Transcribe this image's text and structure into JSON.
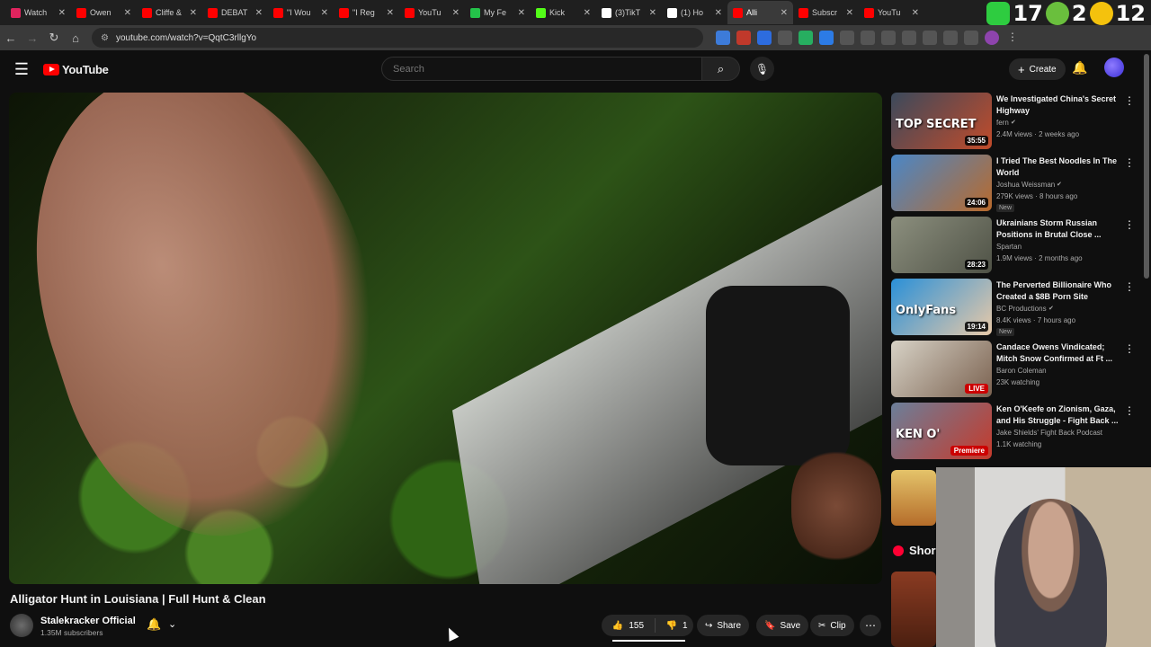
{
  "browser": {
    "tabs": [
      {
        "label": "Watch",
        "favicon_color": "#e0245e"
      },
      {
        "label": "Owen",
        "favicon_color": "#ff0000"
      },
      {
        "label": "Cliffe &",
        "favicon_color": "#ff0000"
      },
      {
        "label": "DEBAT",
        "favicon_color": "#ff0000"
      },
      {
        "label": "\"I Wou",
        "favicon_color": "#ff0000"
      },
      {
        "label": "\"I Reg",
        "favicon_color": "#ff0000"
      },
      {
        "label": "YouTu",
        "favicon_color": "#ff0000"
      },
      {
        "label": "My Fe",
        "favicon_color": "#24c24a"
      },
      {
        "label": "Kick",
        "favicon_color": "#53fc18"
      },
      {
        "label": "(3)TikT",
        "favicon_color": "#ffffff"
      },
      {
        "label": "(1) Ho",
        "favicon_color": "#ffffff"
      },
      {
        "label": "Alli",
        "favicon_color": "#ff0000"
      },
      {
        "label": "Subscr",
        "favicon_color": "#ff0000"
      },
      {
        "label": "YouTu",
        "favicon_color": "#ff0000"
      }
    ],
    "active_tab_index": 11,
    "url": "youtube.com/watch?v=QqtC3rllgYo",
    "overlay_numbers": [
      "17",
      "2",
      "12"
    ]
  },
  "header": {
    "logo_text": "YouTube",
    "search_placeholder": "Search",
    "create_label": "Create"
  },
  "video": {
    "title": "Alligator Hunt in Louisiana | Full Hunt & Clean",
    "channel_name": "Stalekracker Official",
    "subscribers": "1.35M subscribers",
    "likes": "155",
    "dislikes": "1",
    "share_label": "Share",
    "save_label": "Save",
    "clip_label": "Clip"
  },
  "recommendations": [
    {
      "title": "We Investigated China's Secret Highway",
      "channel": "fern",
      "verified": true,
      "meta": "2.4M views · 2 weeks ago",
      "duration": "35:55",
      "thumb_caption": "TOP SECRET",
      "thumb_colors": [
        "#3b4a5c",
        "#c24b2a"
      ],
      "new": false,
      "live": false
    },
    {
      "title": "I Tried The Best Noodles In The World",
      "channel": "Joshua Weissman",
      "verified": true,
      "meta": "279K views · 8 hours ago",
      "duration": "24:06",
      "thumb_caption": "",
      "thumb_colors": [
        "#4a87c7",
        "#b96a2c"
      ],
      "new": true,
      "live": false
    },
    {
      "title": "Ukrainians Storm Russian Positions in Brutal Close ...",
      "channel": "Spartan",
      "verified": false,
      "meta": "1.9M views · 2 months ago",
      "duration": "28:23",
      "thumb_caption": "",
      "thumb_colors": [
        "#8c8f7e",
        "#4f5246"
      ],
      "new": false,
      "live": false
    },
    {
      "title": "The Perverted Billionaire Who Created a $8B Porn Site",
      "channel": "BC Productions",
      "verified": true,
      "meta": "8.4K views · 7 hours ago",
      "duration": "19:14",
      "thumb_caption": "OnlyFans",
      "thumb_colors": [
        "#2a90d8",
        "#e8c9a8"
      ],
      "new": true,
      "live": false
    },
    {
      "title": "Candace Owens Vindicated; Mitch Snow Confirmed at Ft ...",
      "channel": "Baron Coleman",
      "verified": false,
      "meta": "23K watching",
      "duration": "",
      "thumb_caption": "",
      "thumb_colors": [
        "#d7d2c6",
        "#7b6250"
      ],
      "new": false,
      "live": true,
      "live_label": "LIVE"
    },
    {
      "title": "Ken O'Keefe on Zionism, Gaza, and His Struggle - Fight Back ...",
      "channel": "Jake Shields' Fight Back Podcast",
      "verified": false,
      "meta": "1.1K watching",
      "duration": "",
      "thumb_caption": "KEN O'",
      "thumb_colors": [
        "#6b7f9a",
        "#c63a2b"
      ],
      "new": false,
      "live": true,
      "live_label": "Premiere"
    }
  ],
  "new_label": "New",
  "shorts_label": "Shor"
}
